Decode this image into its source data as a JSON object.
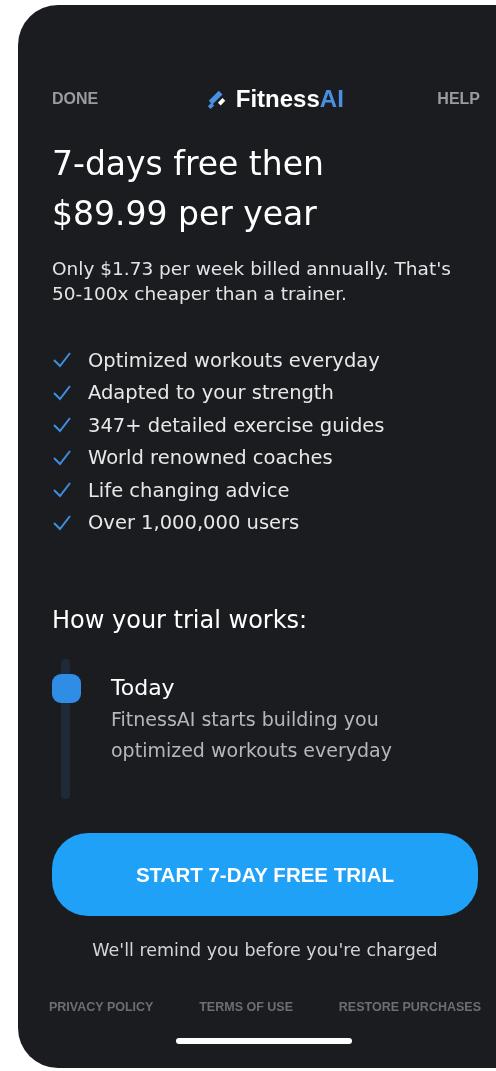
{
  "header": {
    "left": "DONE",
    "right": "HELP",
    "logo": {
      "name": "Fitness",
      "accent": "AI"
    }
  },
  "title": "7-days free then $89.99 per year",
  "subtitle": "Only $1.73 per week billed annually. That's 50-100x cheaper than a trainer.",
  "features": [
    "Optimized workouts everyday",
    "Adapted to your strength",
    "347+ detailed exercise guides",
    "World renowned coaches",
    "Life changing advice",
    "Over 1,000,000 users"
  ],
  "trial": {
    "heading": "How your trial works:",
    "steps": [
      {
        "title": "Today",
        "text": "FitnessAI starts building you optimized workouts everyday"
      }
    ]
  },
  "cta": "START 7-DAY FREE TRIAL",
  "reminder": "We'll remind you before you're charged",
  "footer_links": [
    "PRIVACY POLICY",
    "TERMS OF USE",
    "RESTORE PURCHASES"
  ]
}
